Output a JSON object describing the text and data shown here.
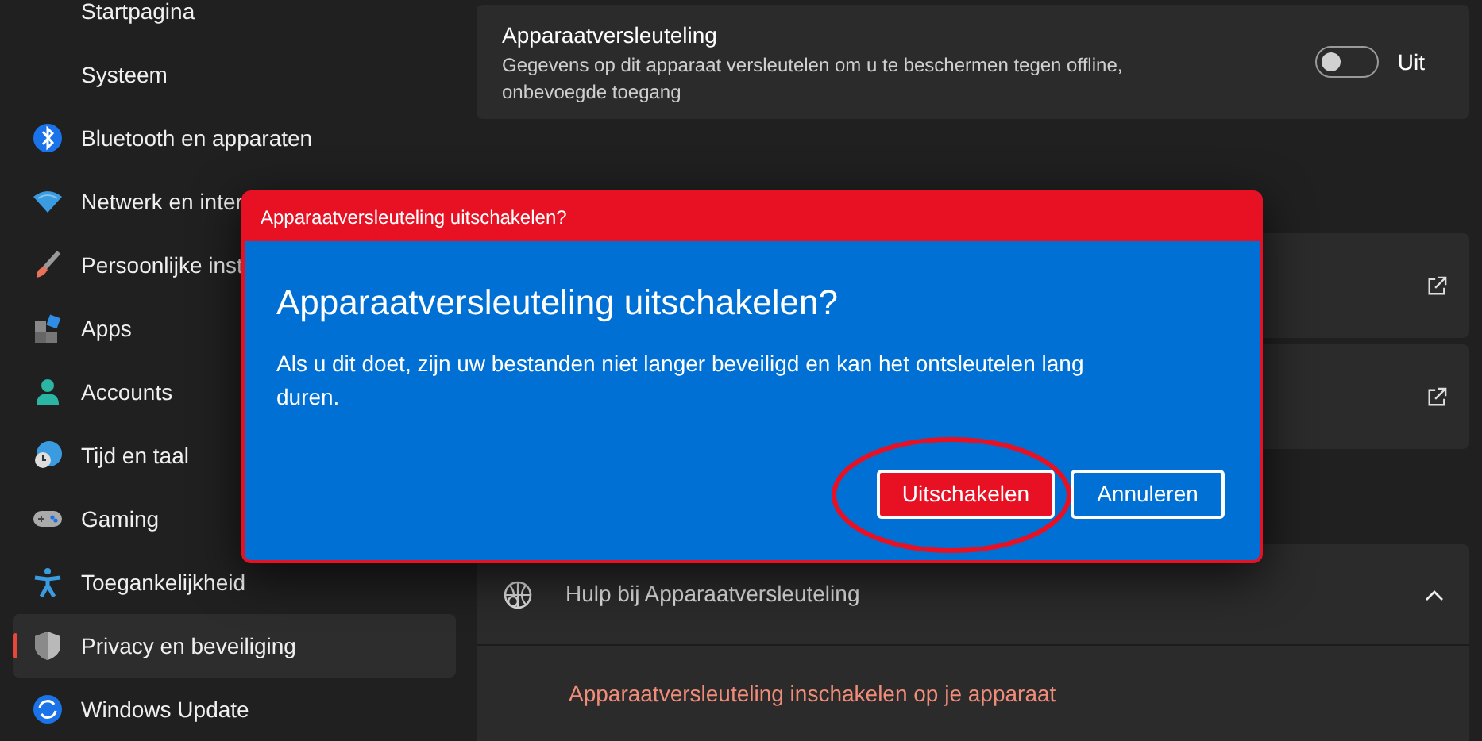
{
  "sidebar": {
    "items": [
      {
        "label": "Startpagina",
        "selected": false
      },
      {
        "label": "Systeem",
        "selected": false
      },
      {
        "label": "Bluetooth en apparaten",
        "selected": false
      },
      {
        "label": "Netwerk en inter",
        "selected": false
      },
      {
        "label": "Persoonlijke inst",
        "selected": false
      },
      {
        "label": "Apps",
        "selected": false
      },
      {
        "label": "Accounts",
        "selected": false
      },
      {
        "label": "Tijd en taal",
        "selected": false
      },
      {
        "label": "Gaming",
        "selected": false
      },
      {
        "label": "Toegankelijkheid",
        "selected": false
      },
      {
        "label": "Privacy en beveiliging",
        "selected": true
      },
      {
        "label": "Windows Update",
        "selected": false
      }
    ]
  },
  "encryption_card": {
    "title": "Apparaatversleuteling",
    "description": "Gegevens op dit apparaat versleutelen om u te beschermen tegen offline, onbevoegde toegang",
    "toggle": {
      "on": false,
      "label": "Uit"
    }
  },
  "link_cards": [
    {
      "kind": "external"
    },
    {
      "kind": "external"
    }
  ],
  "help_section": {
    "title": "Hulp bij Apparaatversleuteling",
    "expanded": true,
    "links": [
      "Apparaatversleuteling inschakelen op je apparaat"
    ]
  },
  "dialog": {
    "title": "Apparaatversleuteling uitschakelen?",
    "heading": "Apparaatversleuteling uitschakelen?",
    "message": "Als u dit doet, zijn uw bestanden niet langer beveiligd en kan het ontsleutelen lang duren.",
    "buttons": [
      {
        "label": "Uitschakelen",
        "kind": "primary",
        "circled": true
      },
      {
        "label": "Annuleren",
        "kind": "secondary",
        "circled": false
      }
    ]
  }
}
